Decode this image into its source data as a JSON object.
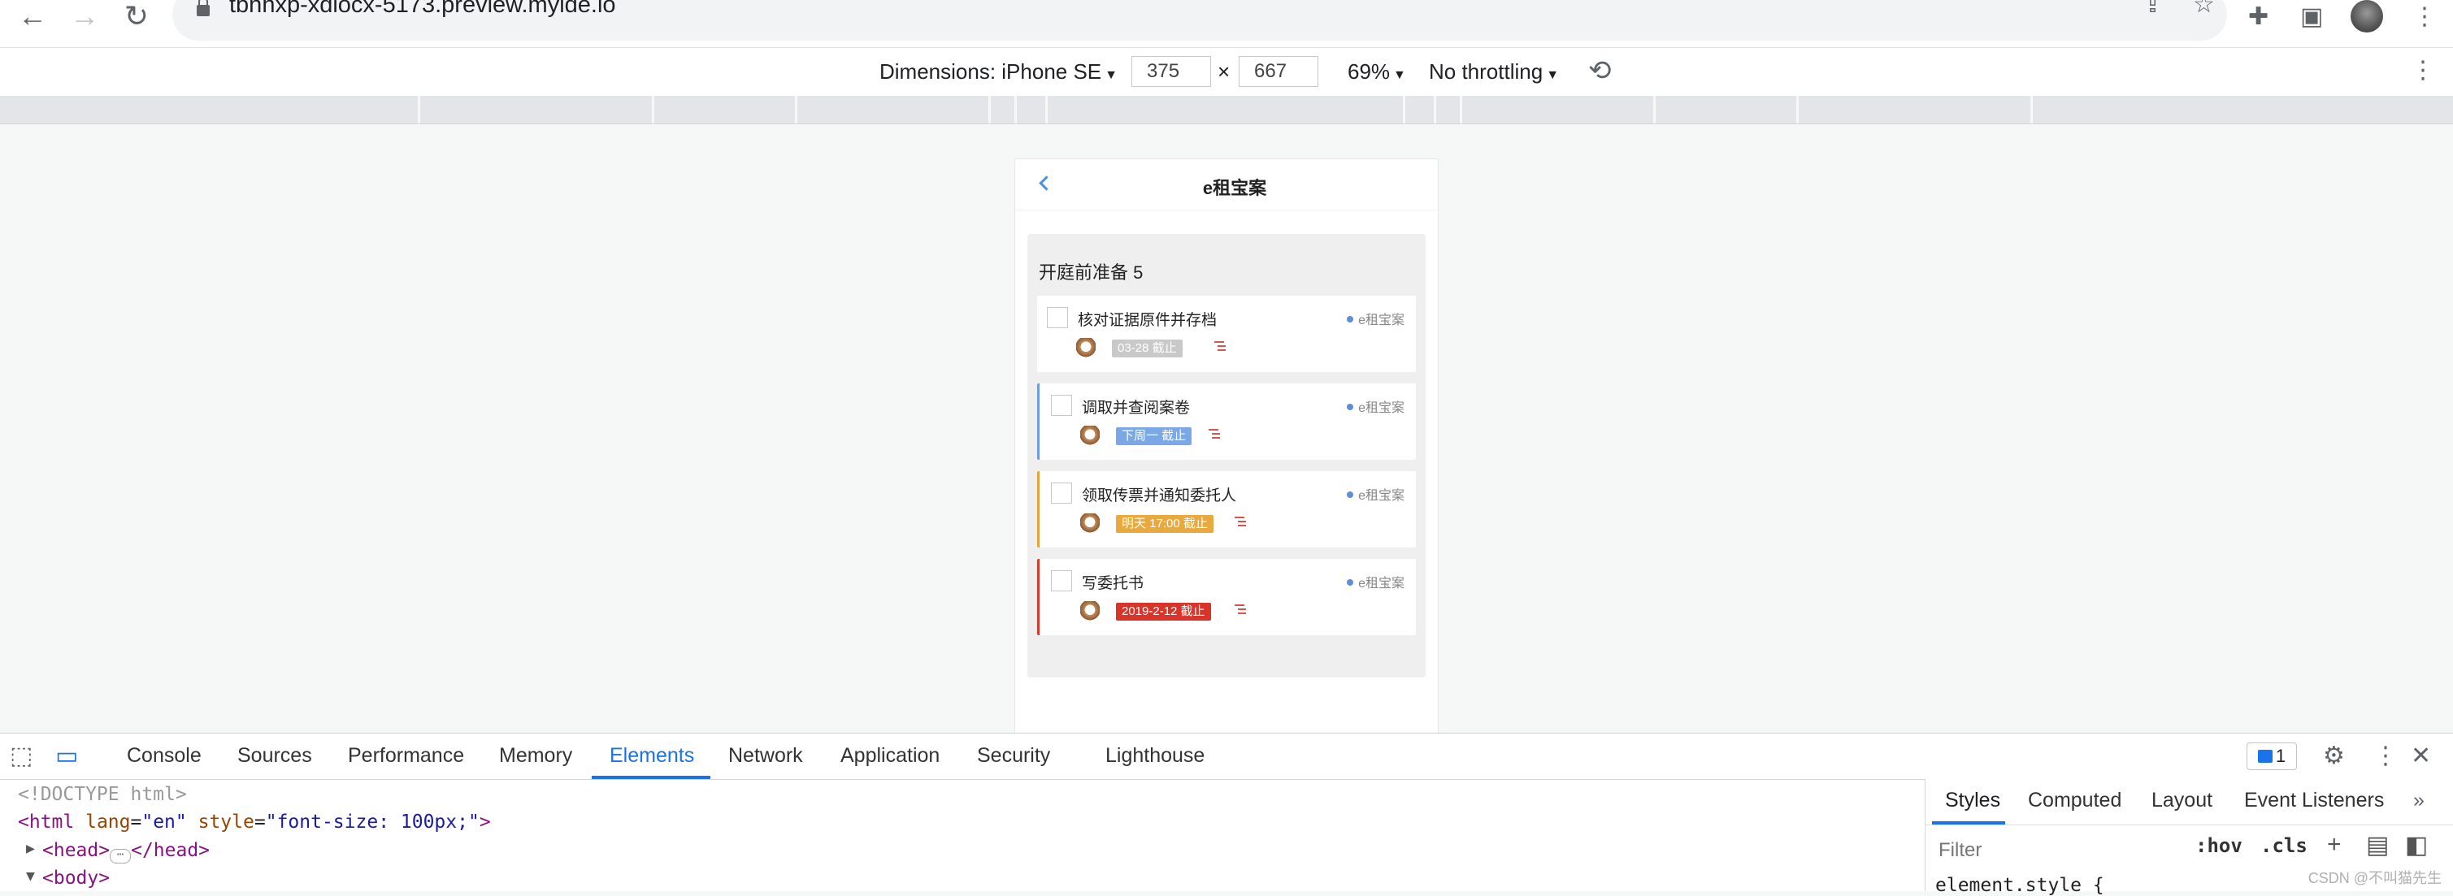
{
  "browser": {
    "url": "tbnhxp-xdiocx-5173.preview.myide.io",
    "icons": {
      "back": "arrow-left-icon",
      "forward": "arrow-right-icon",
      "reload": "reload-icon",
      "lock": "lock-icon",
      "share": "share-icon",
      "bookmark": "star-icon",
      "extensions": "puzzle-icon",
      "side_panel": "side-panel-icon",
      "menu": "kebab-menu-icon"
    }
  },
  "device_toolbar": {
    "dimensions_label": "Dimensions: iPhone SE",
    "width": "375",
    "times": "×",
    "height": "667",
    "zoom": "69%",
    "throttling": "No throttling"
  },
  "app": {
    "title": "e租宝案",
    "group": {
      "title": "开庭前准备 5",
      "tasks": [
        {
          "title": "核对证据原件并存档",
          "project": "e租宝案",
          "due": "03-28 截止",
          "due_color": "#c9c9c9",
          "border": "none"
        },
        {
          "title": "调取并查阅案卷",
          "project": "e租宝案",
          "due": "下周一 截止",
          "due_color": "#7aa7e6",
          "border": "#6f9be0"
        },
        {
          "title": "领取传票并通知委托人",
          "project": "e租宝案",
          "due": "明天 17:00 截止",
          "due_color": "#e9a93c",
          "border": "#e6a23c"
        },
        {
          "title": "写委托书",
          "project": "e租宝案",
          "due": "2019-2-12 截止",
          "due_color": "#d9342a",
          "border": "#d33b2c"
        }
      ]
    }
  },
  "devtools": {
    "tabs": [
      "Console",
      "Sources",
      "Performance",
      "Memory",
      "Elements",
      "Network",
      "Application",
      "Security",
      "Lighthouse"
    ],
    "active_tab": "Elements",
    "issues_count": "1",
    "code": {
      "doctype": "<!DOCTYPE html>",
      "html_open": "<html",
      "lang_attr": "lang",
      "lang_val": "\"en\"",
      "style_attr": "style",
      "style_val": "\"font-size: 100px;\"",
      "html_close": ">",
      "head_open": "<head>",
      "head_close": "</head>",
      "body_open": "<body>"
    },
    "styles_tabs": [
      "Styles",
      "Computed",
      "Layout",
      "Event Listeners"
    ],
    "filter_placeholder": "Filter",
    "hov": ":hov",
    "cls": ".cls",
    "element_style": "element.style {"
  },
  "watermark": "CSDN @不叫猫先生"
}
